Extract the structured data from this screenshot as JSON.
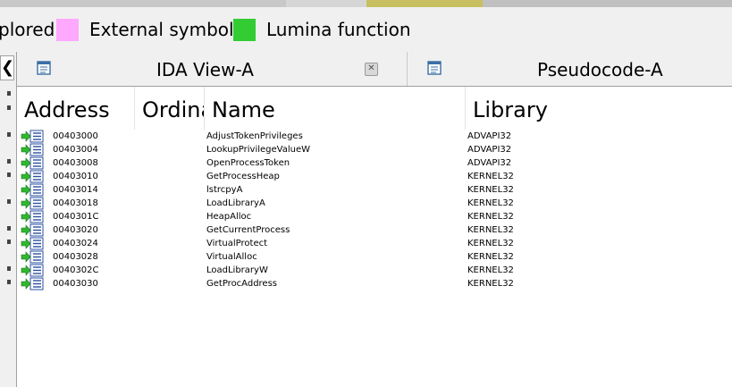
{
  "legend": {
    "items": [
      {
        "label": "plored",
        "color": ""
      },
      {
        "label": "External symbol",
        "color": "#ffa8ff"
      },
      {
        "label": "Lumina function",
        "color": "#33cc33"
      }
    ]
  },
  "tabs": [
    {
      "label": "IDA View-A",
      "closable": true
    },
    {
      "label": "Pseudocode-A",
      "closable": false
    }
  ],
  "table": {
    "columns": [
      "Address",
      "Ordinal",
      "Name",
      "Library"
    ],
    "rows": [
      {
        "address": "00403000",
        "name": "AdjustTokenPrivileges",
        "library": "ADVAPI32"
      },
      {
        "address": "00403004",
        "name": "LookupPrivilegeValueW",
        "library": "ADVAPI32"
      },
      {
        "address": "00403008",
        "name": "OpenProcessToken",
        "library": "ADVAPI32"
      },
      {
        "address": "00403010",
        "name": "GetProcessHeap",
        "library": "KERNEL32"
      },
      {
        "address": "00403014",
        "name": "lstrcpyA",
        "library": "KERNEL32"
      },
      {
        "address": "00403018",
        "name": "LoadLibraryA",
        "library": "KERNEL32"
      },
      {
        "address": "0040301C",
        "name": "HeapAlloc",
        "library": "KERNEL32"
      },
      {
        "address": "00403020",
        "name": "GetCurrentProcess",
        "library": "KERNEL32"
      },
      {
        "address": "00403024",
        "name": "VirtualProtect",
        "library": "KERNEL32"
      },
      {
        "address": "00403028",
        "name": "VirtualAlloc",
        "library": "KERNEL32"
      },
      {
        "address": "0040302C",
        "name": "LoadLibraryW",
        "library": "KERNEL32"
      },
      {
        "address": "00403030",
        "name": "GetProcAddress",
        "library": "KERNEL32"
      }
    ]
  },
  "icons": {
    "row": "import-entry-icon",
    "tab": "ida-window-icon",
    "close": "close-icon",
    "collapse": "chevron-left-icon"
  }
}
